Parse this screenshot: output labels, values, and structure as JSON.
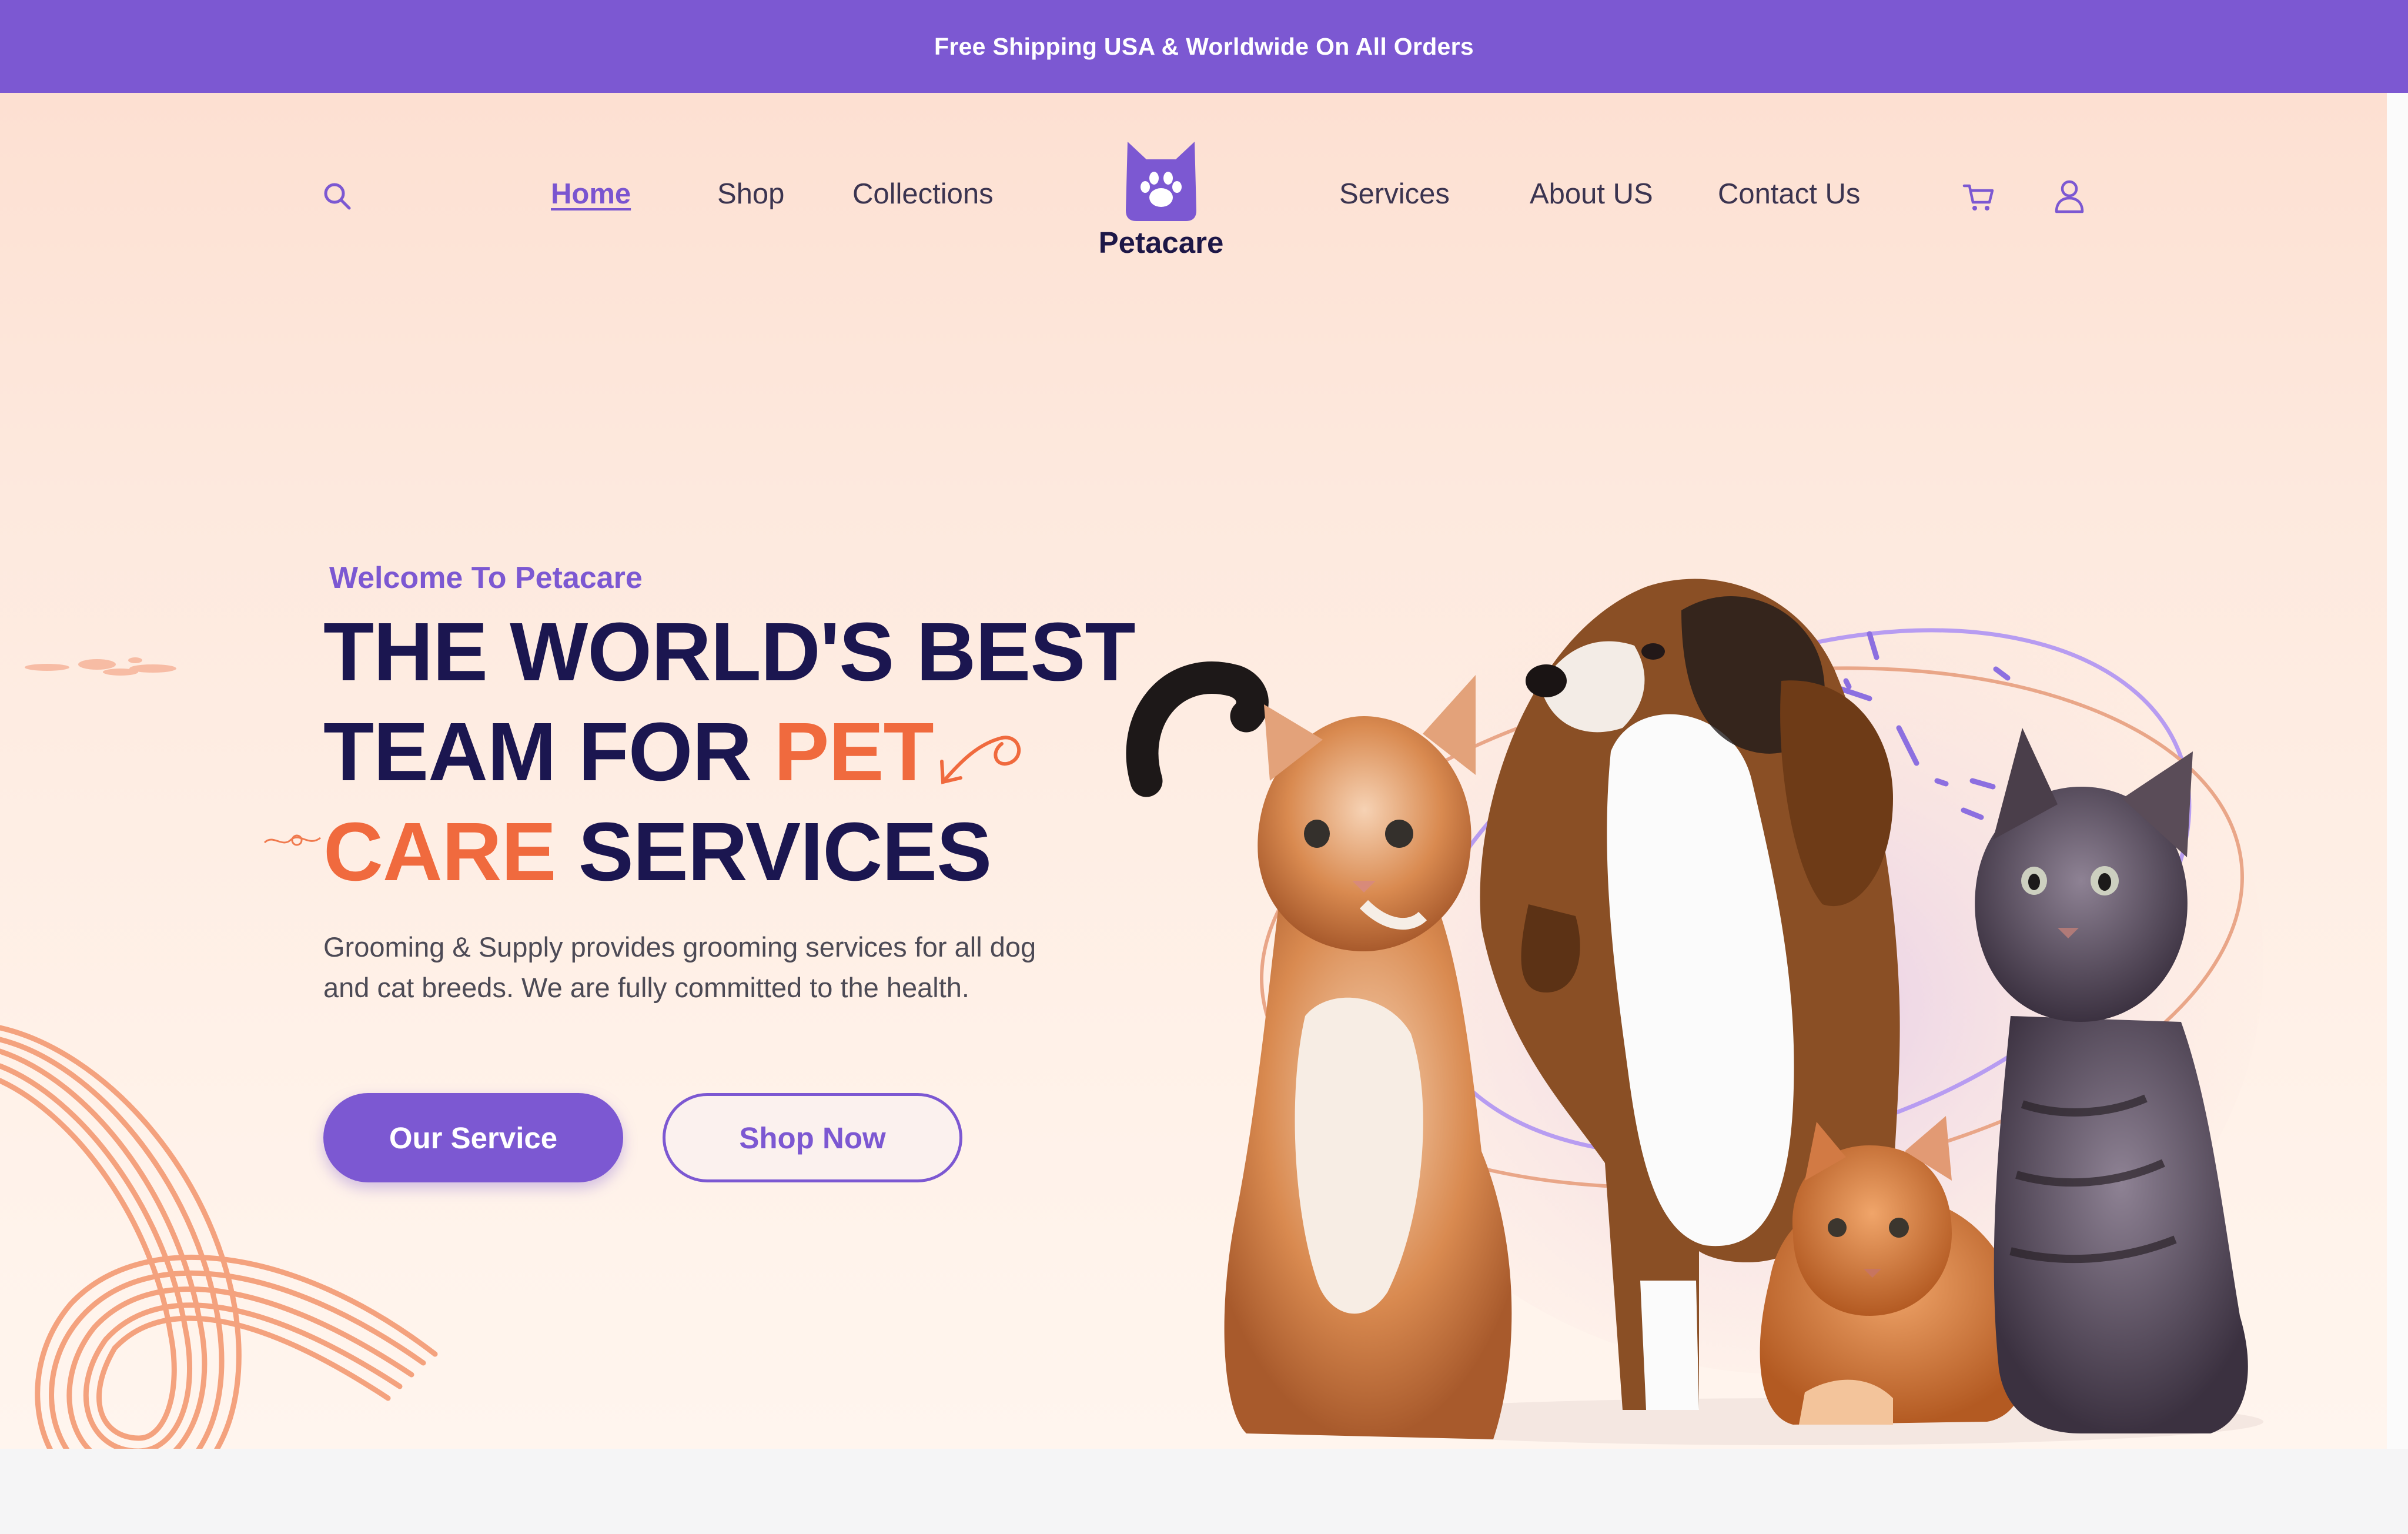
{
  "announcement": {
    "text": "Free Shipping USA & Worldwide On All Orders"
  },
  "nav": {
    "left_links": [
      {
        "label": "Home",
        "active": true
      },
      {
        "label": "Shop",
        "active": false
      },
      {
        "label": "Collections",
        "active": false
      }
    ],
    "right_links": [
      {
        "label": "Services"
      },
      {
        "label": "About US"
      },
      {
        "label": "Contact Us"
      }
    ],
    "icons": {
      "search": "search-icon",
      "cart": "cart-icon",
      "account": "user-icon"
    }
  },
  "logo": {
    "name": "Petacare",
    "icon": "cat-paw-logo-icon"
  },
  "hero": {
    "welcome": "Welcome To Petacare",
    "headline_line1": "THE WORLD'S BEST",
    "headline_line2_prefix": "TEAM FOR ",
    "headline_line2_accent": "PET",
    "headline_line3_accent": "CARE",
    "headline_line3_suffix": " SERVICES",
    "description": "Grooming & Supply provides grooming services for all dog and cat breeds. We are fully committed to the health.",
    "primary_button": "Our Service",
    "secondary_button": "Shop Now",
    "image": "beagle-puppy-and-three-kittens"
  },
  "colors": {
    "brand_purple": "#7c58d2",
    "navy": "#1b1650",
    "accent_orange": "#f06a3e",
    "hero_peach": "#fde4d8"
  }
}
